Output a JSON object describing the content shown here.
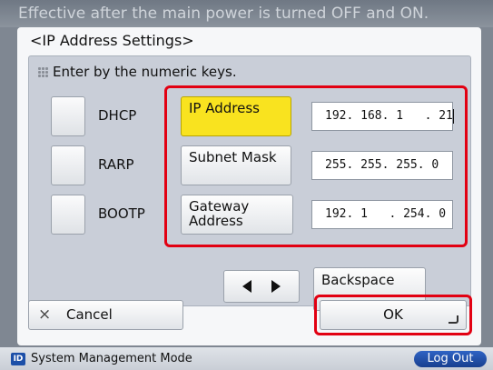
{
  "header": {
    "text": "Effective after the main power is turned OFF and ON."
  },
  "dialog": {
    "title": "<IP Address Settings>",
    "hint": "Enter by the numeric keys.",
    "options": {
      "dhcp": "DHCP",
      "rarp": "RARP",
      "bootp": "BOOTP"
    },
    "fields": [
      {
        "label": "IP Address",
        "value": "192. 168. 1   . 21",
        "active": true
      },
      {
        "label": "Subnet Mask",
        "value": "255. 255. 255. 0",
        "active": false
      },
      {
        "label": "Gateway Address",
        "value": "192. 1   . 254. 0",
        "active": false
      }
    ],
    "backspace_label": "Backspace",
    "cancel_label": "Cancel",
    "ok_label": "OK"
  },
  "status_bar": {
    "mode_label": "System Management Mode",
    "mode_icon": "ID",
    "logout_label": "Log Out"
  },
  "colors": {
    "active_field": "#f9e31f",
    "highlight_frame": "#e20012",
    "logout_button": "#1c4fa8"
  }
}
